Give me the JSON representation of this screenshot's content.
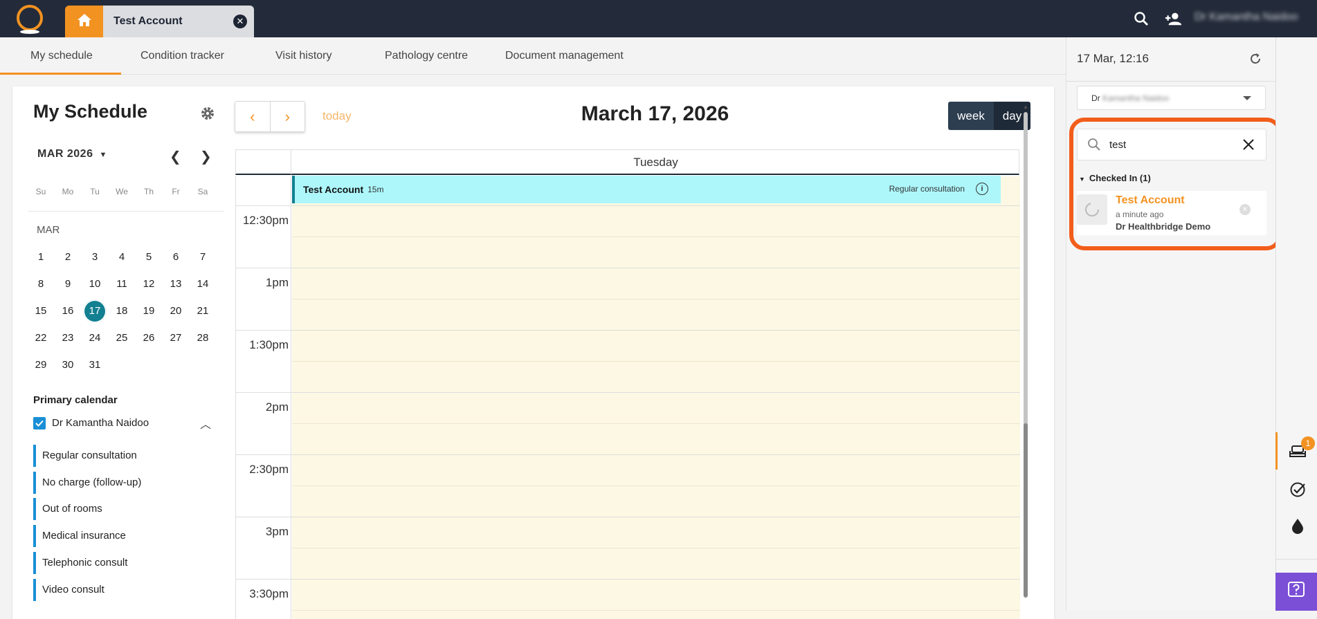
{
  "app": {
    "tab_title": "Test Account",
    "user_name": "Dr Kamantha Naidoo"
  },
  "nav": {
    "tabs": [
      "My schedule",
      "Condition tracker",
      "Visit history",
      "Pathology centre",
      "Document management"
    ],
    "active": "My schedule"
  },
  "schedule": {
    "title": "My Schedule",
    "mini_calendar": {
      "month_selector": "MAR 2026",
      "weekdays": [
        "Su",
        "Mo",
        "Tu",
        "We",
        "Th",
        "Fr",
        "Sa"
      ],
      "month_label": "MAR",
      "weeks": [
        [
          "1",
          "2",
          "3",
          "4",
          "5",
          "6",
          "7"
        ],
        [
          "8",
          "9",
          "10",
          "11",
          "12",
          "13",
          "14"
        ],
        [
          "15",
          "16",
          "17",
          "18",
          "19",
          "20",
          "21"
        ],
        [
          "22",
          "23",
          "24",
          "25",
          "26",
          "27",
          "28"
        ],
        [
          "29",
          "30",
          "31"
        ]
      ],
      "selected_day": "17"
    },
    "primary_calendar": {
      "title": "Primary calendar",
      "name": "Dr Kamantha Naidoo",
      "checked": true,
      "types": [
        "Regular consultation",
        "No charge (follow-up)",
        "Out of rooms",
        "Medical insurance",
        "Telephonic consult",
        "Video consult"
      ],
      "type_color": "#1a8fd6"
    }
  },
  "calendar": {
    "today_label": "today",
    "title": "March 17, 2026",
    "views": {
      "week": "week",
      "day": "day"
    },
    "active_view": "day",
    "day_name": "Tuesday",
    "time_labels": [
      "12:30pm",
      "1pm",
      "1:30pm",
      "2pm",
      "2:30pm",
      "3pm",
      "3:30pm"
    ],
    "event": {
      "name": "Test Account",
      "duration": "15m",
      "type": "Regular consultation",
      "info": "i"
    },
    "colors": {
      "day_bg": "#fcf8e3",
      "event_bg": "#adf7fb",
      "event_border": "#138091"
    }
  },
  "sidebar": {
    "datetime": "17 Mar, 12:16",
    "provider_select": {
      "prefix": "Dr",
      "name": "Kamantha Naidoo"
    },
    "search": {
      "value": "test"
    },
    "checked_in": {
      "title": "Checked In (1)",
      "items": [
        {
          "name": "Test Account",
          "time": "a minute ago",
          "doctor": "Dr Healthbridge Demo"
        }
      ]
    },
    "highlight_color": "#f25d1a"
  },
  "rail": {
    "badge_count": "1"
  },
  "accent": "#f29221"
}
